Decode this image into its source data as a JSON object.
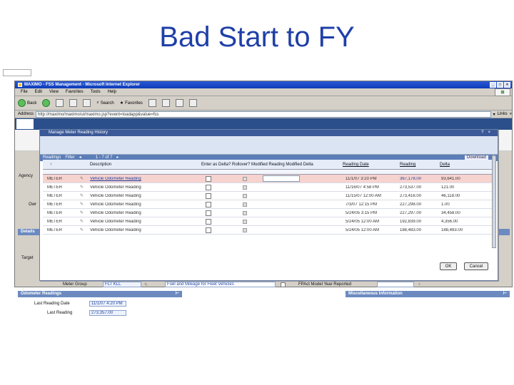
{
  "slide": {
    "title": "Bad Start to FY"
  },
  "browser": {
    "title": "MAXIMO - FSS Management - Microsoft Internet Explorer",
    "menu": [
      "File",
      "Edit",
      "View",
      "Favorites",
      "Tools",
      "Help"
    ],
    "toolbar": {
      "back": "Back",
      "search": "Search",
      "favorites": "Favorites"
    },
    "address_label": "Address",
    "address_value": "http://maximo/maximo/ui/maximo.jsp?event=loadapp&value=fss",
    "links": "Links"
  },
  "app": {
    "left_labels": [
      "Agency",
      "Owr"
    ],
    "section_bar_label": "Details",
    "target_label": "Target",
    "meter_group_label": "Meter Group",
    "meter_group_value": "FLT KLL",
    "meter_group_desc": "Fuel and Mileage for Fleet Vehicles",
    "fpact_label": "FPAct Model Year Reported",
    "odometer_section": "Odometer Readings",
    "misc_section": "Miscellaneous Information",
    "last_reading_date_label": "Last Reading Date",
    "last_reading_date_value": "11/1/07 4:20 PM",
    "last_reading_label": "Last Reading",
    "last_reading_value": "273,357.00"
  },
  "dialog": {
    "title": "Manage Meter Reading History",
    "grid_label": "Readings",
    "filter_label": "Filter",
    "pager": "1 - 7 of 7",
    "download_label": "Download",
    "headers": {
      "meter": "Meter",
      "description": "Description",
      "flags": "Enter as Delta? Rollover? Modified Reading Modified Delta",
      "reading_date": "Reading Date",
      "reading": "Reading",
      "delta": "Delta"
    },
    "rows": [
      {
        "meter": "METER",
        "desc": "Vehicle Odometer Reading",
        "date": "11/1/07 3:20 PM",
        "reading": "367,178.00",
        "delta": "93,641.00"
      },
      {
        "meter": "METER",
        "desc": "Vehicle Odometer Reading",
        "date": "11/16/07 4:58 PM",
        "reading": "273,537.00",
        "delta": "121.00"
      },
      {
        "meter": "METER",
        "desc": "Vehicle Odometer Reading",
        "date": "11/15/07 12:00 AM",
        "reading": "273,416.00",
        "delta": "46,118.00"
      },
      {
        "meter": "METER",
        "desc": "Vehicle Odometer Reading",
        "date": "7/3/07 12:15 PM",
        "reading": "227,298.00",
        "delta": "1.00"
      },
      {
        "meter": "METER",
        "desc": "Vehicle Odometer Reading",
        "date": "5/24/05 3:15 PM",
        "reading": "227,297.00",
        "delta": "34,458.00"
      },
      {
        "meter": "METER",
        "desc": "Vehicle Odometer Reading",
        "date": "5/24/05 12:00 AM",
        "reading": "192,839.00",
        "delta": "4,356.00"
      },
      {
        "meter": "METER",
        "desc": "Vehicle Odometer Reading",
        "date": "5/24/05 12:00 AM",
        "reading": "188,483.00",
        "delta": "188,483.00"
      }
    ],
    "ok_label": "OK",
    "cancel_label": "Cancel"
  }
}
